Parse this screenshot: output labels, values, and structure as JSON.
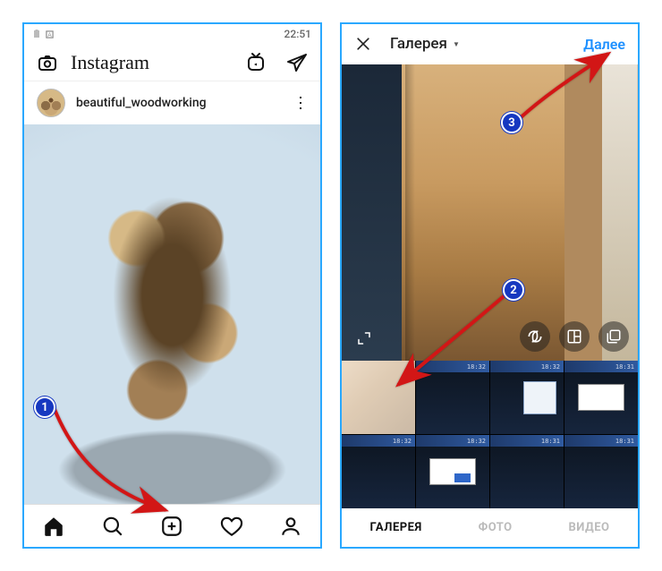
{
  "status": {
    "time": "22:51"
  },
  "header": {
    "logo_text": "Instagram"
  },
  "post": {
    "username": "beautiful_woodworking"
  },
  "bottom_nav": {
    "home": "home",
    "search": "search",
    "add": "add",
    "activity": "activity",
    "profile": "profile"
  },
  "picker": {
    "title": "Галерея",
    "next": "Далее",
    "tabs": {
      "gallery": "ГАЛЕРЕЯ",
      "photo": "ФОТО",
      "video": "ВИДЕО"
    },
    "thumbs": [
      {
        "t": ""
      },
      {
        "t": "18:32"
      },
      {
        "t": "18:32"
      },
      {
        "t": "18:31"
      },
      {
        "t": "18:32"
      },
      {
        "t": "18:32"
      },
      {
        "t": "18:31"
      },
      {
        "t": "18:31"
      }
    ]
  },
  "steps": {
    "s1": "1",
    "s2": "2",
    "s3": "3"
  }
}
